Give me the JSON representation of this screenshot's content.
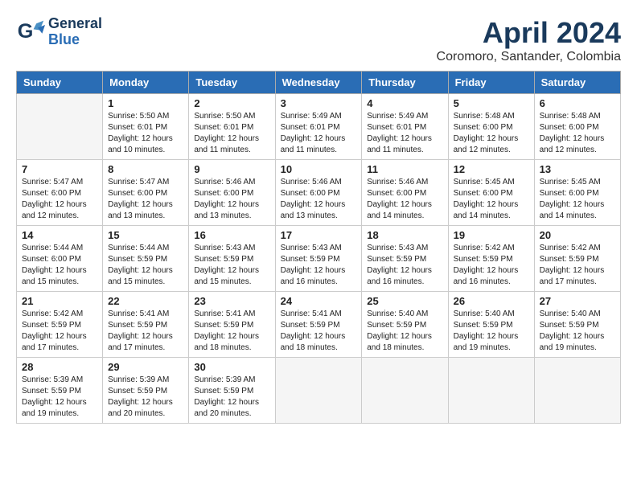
{
  "header": {
    "logo_general": "General",
    "logo_blue": "Blue",
    "month_title": "April 2024",
    "location": "Coromoro, Santander, Colombia"
  },
  "weekdays": [
    "Sunday",
    "Monday",
    "Tuesday",
    "Wednesday",
    "Thursday",
    "Friday",
    "Saturday"
  ],
  "weeks": [
    [
      {
        "day": "",
        "info": ""
      },
      {
        "day": "1",
        "info": "Sunrise: 5:50 AM\nSunset: 6:01 PM\nDaylight: 12 hours\nand 10 minutes."
      },
      {
        "day": "2",
        "info": "Sunrise: 5:50 AM\nSunset: 6:01 PM\nDaylight: 12 hours\nand 11 minutes."
      },
      {
        "day": "3",
        "info": "Sunrise: 5:49 AM\nSunset: 6:01 PM\nDaylight: 12 hours\nand 11 minutes."
      },
      {
        "day": "4",
        "info": "Sunrise: 5:49 AM\nSunset: 6:01 PM\nDaylight: 12 hours\nand 11 minutes."
      },
      {
        "day": "5",
        "info": "Sunrise: 5:48 AM\nSunset: 6:00 PM\nDaylight: 12 hours\nand 12 minutes."
      },
      {
        "day": "6",
        "info": "Sunrise: 5:48 AM\nSunset: 6:00 PM\nDaylight: 12 hours\nand 12 minutes."
      }
    ],
    [
      {
        "day": "7",
        "info": "Sunrise: 5:47 AM\nSunset: 6:00 PM\nDaylight: 12 hours\nand 12 minutes."
      },
      {
        "day": "8",
        "info": "Sunrise: 5:47 AM\nSunset: 6:00 PM\nDaylight: 12 hours\nand 13 minutes."
      },
      {
        "day": "9",
        "info": "Sunrise: 5:46 AM\nSunset: 6:00 PM\nDaylight: 12 hours\nand 13 minutes."
      },
      {
        "day": "10",
        "info": "Sunrise: 5:46 AM\nSunset: 6:00 PM\nDaylight: 12 hours\nand 13 minutes."
      },
      {
        "day": "11",
        "info": "Sunrise: 5:46 AM\nSunset: 6:00 PM\nDaylight: 12 hours\nand 14 minutes."
      },
      {
        "day": "12",
        "info": "Sunrise: 5:45 AM\nSunset: 6:00 PM\nDaylight: 12 hours\nand 14 minutes."
      },
      {
        "day": "13",
        "info": "Sunrise: 5:45 AM\nSunset: 6:00 PM\nDaylight: 12 hours\nand 14 minutes."
      }
    ],
    [
      {
        "day": "14",
        "info": "Sunrise: 5:44 AM\nSunset: 6:00 PM\nDaylight: 12 hours\nand 15 minutes."
      },
      {
        "day": "15",
        "info": "Sunrise: 5:44 AM\nSunset: 5:59 PM\nDaylight: 12 hours\nand 15 minutes."
      },
      {
        "day": "16",
        "info": "Sunrise: 5:43 AM\nSunset: 5:59 PM\nDaylight: 12 hours\nand 15 minutes."
      },
      {
        "day": "17",
        "info": "Sunrise: 5:43 AM\nSunset: 5:59 PM\nDaylight: 12 hours\nand 16 minutes."
      },
      {
        "day": "18",
        "info": "Sunrise: 5:43 AM\nSunset: 5:59 PM\nDaylight: 12 hours\nand 16 minutes."
      },
      {
        "day": "19",
        "info": "Sunrise: 5:42 AM\nSunset: 5:59 PM\nDaylight: 12 hours\nand 16 minutes."
      },
      {
        "day": "20",
        "info": "Sunrise: 5:42 AM\nSunset: 5:59 PM\nDaylight: 12 hours\nand 17 minutes."
      }
    ],
    [
      {
        "day": "21",
        "info": "Sunrise: 5:42 AM\nSunset: 5:59 PM\nDaylight: 12 hours\nand 17 minutes."
      },
      {
        "day": "22",
        "info": "Sunrise: 5:41 AM\nSunset: 5:59 PM\nDaylight: 12 hours\nand 17 minutes."
      },
      {
        "day": "23",
        "info": "Sunrise: 5:41 AM\nSunset: 5:59 PM\nDaylight: 12 hours\nand 18 minutes."
      },
      {
        "day": "24",
        "info": "Sunrise: 5:41 AM\nSunset: 5:59 PM\nDaylight: 12 hours\nand 18 minutes."
      },
      {
        "day": "25",
        "info": "Sunrise: 5:40 AM\nSunset: 5:59 PM\nDaylight: 12 hours\nand 18 minutes."
      },
      {
        "day": "26",
        "info": "Sunrise: 5:40 AM\nSunset: 5:59 PM\nDaylight: 12 hours\nand 19 minutes."
      },
      {
        "day": "27",
        "info": "Sunrise: 5:40 AM\nSunset: 5:59 PM\nDaylight: 12 hours\nand 19 minutes."
      }
    ],
    [
      {
        "day": "28",
        "info": "Sunrise: 5:39 AM\nSunset: 5:59 PM\nDaylight: 12 hours\nand 19 minutes."
      },
      {
        "day": "29",
        "info": "Sunrise: 5:39 AM\nSunset: 5:59 PM\nDaylight: 12 hours\nand 20 minutes."
      },
      {
        "day": "30",
        "info": "Sunrise: 5:39 AM\nSunset: 5:59 PM\nDaylight: 12 hours\nand 20 minutes."
      },
      {
        "day": "",
        "info": ""
      },
      {
        "day": "",
        "info": ""
      },
      {
        "day": "",
        "info": ""
      },
      {
        "day": "",
        "info": ""
      }
    ]
  ]
}
